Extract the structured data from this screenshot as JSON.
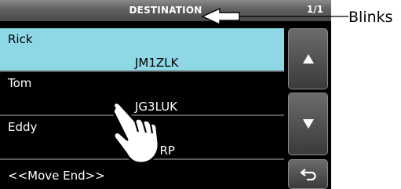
{
  "header": {
    "title": "DESTINATION",
    "page": "1/1"
  },
  "rows": [
    {
      "name": "Rick",
      "callsign": "JM1ZLK",
      "selected": true
    },
    {
      "name": "Tom",
      "callsign": "JG3LUK",
      "selected": false
    },
    {
      "name": "Eddy",
      "callsign": "JL3YRP",
      "selected": false
    },
    {
      "name": "<<Move End>>",
      "callsign": "",
      "selected": false
    }
  ],
  "callout": {
    "label": "Blinks"
  },
  "icons": {
    "up": "triangle-up-icon",
    "down": "triangle-down-icon",
    "back": "return-arrow-icon",
    "pointer": "hand-pointer-icon"
  },
  "colors": {
    "selected_row": "#8ed8e6",
    "background": "#000000",
    "title_bar": "#6a6a6a"
  }
}
